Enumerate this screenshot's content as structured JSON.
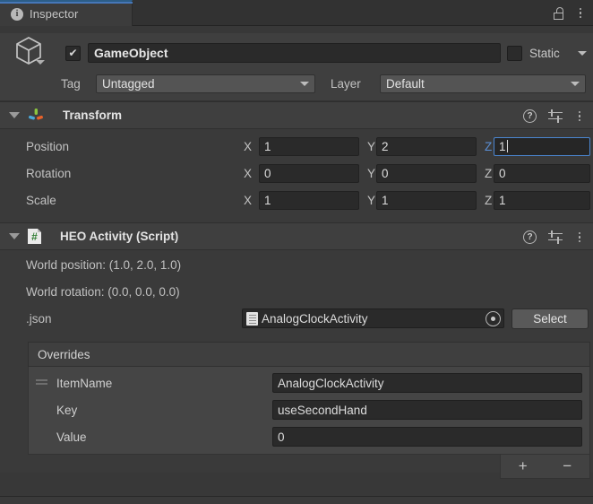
{
  "window": {
    "tab_label": "Inspector",
    "tab_icon": "info-icon",
    "lock_icon": "lock-open-icon",
    "menu_icon": "kebab-menu-icon",
    "accent_color": "#4677b8"
  },
  "gameobject": {
    "enabled_checkbox": "✔",
    "name": "GameObject",
    "static_label": "Static",
    "tag_label": "Tag",
    "tag_value": "Untagged",
    "layer_label": "Layer",
    "layer_value": "Default",
    "prefab_icon": "cube-icon"
  },
  "transform": {
    "title": "Transform",
    "icon": "transform-axis-icon",
    "help_icon": "help-icon",
    "preset_icon": "preset-settings-icon",
    "menu_icon": "kebab-menu-icon",
    "rows": [
      {
        "label": "Position",
        "x": "1",
        "y": "2",
        "z": "1",
        "z_focused": true
      },
      {
        "label": "Rotation",
        "x": "0",
        "y": "0",
        "z": "0",
        "z_focused": false
      },
      {
        "label": "Scale",
        "x": "1",
        "y": "1",
        "z": "1",
        "z_focused": false
      }
    ],
    "axis_labels": {
      "x": "X",
      "y": "Y",
      "z": "Z"
    },
    "focus_color": "#4b86d1"
  },
  "heo_activity": {
    "title": "HEO Activity (Script)",
    "icon": "csharp-script-icon",
    "help_icon": "help-icon",
    "preset_icon": "preset-settings-icon",
    "menu_icon": "kebab-menu-icon",
    "world_position": "World position: (1.0, 2.0, 1.0)",
    "world_rotation": "World rotation: (0.0, 0.0, 0.0)",
    "json_label": ".json",
    "json_value": "AnalogClockActivity",
    "json_asset_icon": "text-asset-icon",
    "json_picker_icon": "object-picker-icon",
    "select_button": "Select",
    "overrides": {
      "header": "Overrides",
      "rows": [
        {
          "label": "ItemName",
          "value": "AnalogClockActivity",
          "handle": true
        },
        {
          "label": "Key",
          "value": "useSecondHand",
          "handle": false
        },
        {
          "label": "Value",
          "value": "0",
          "handle": false
        }
      ],
      "add_button": "+",
      "remove_button": "−"
    }
  }
}
